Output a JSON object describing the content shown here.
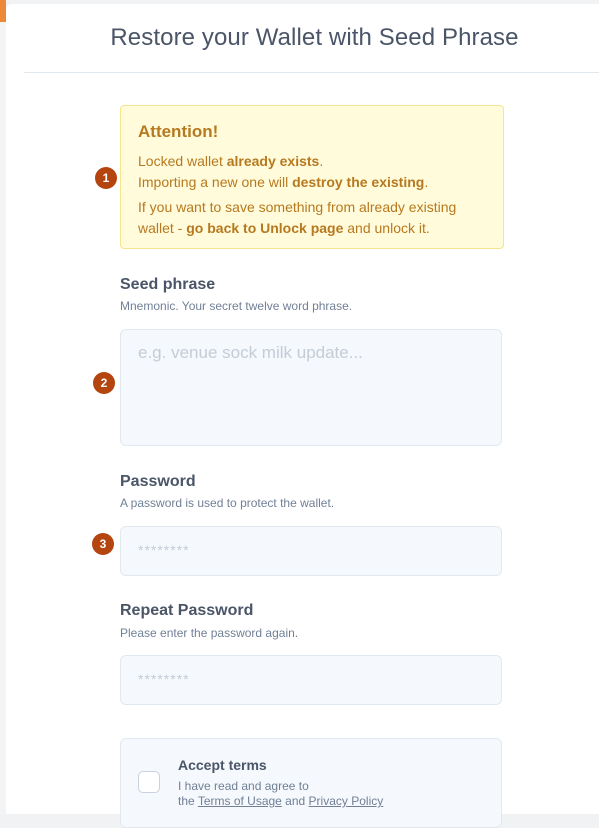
{
  "page": {
    "title": "Restore your Wallet with Seed Phrase"
  },
  "badges": [
    "1",
    "2",
    "3"
  ],
  "alert": {
    "title": "Attention!",
    "line1_pre": "Locked wallet ",
    "line1_bold": "already exists",
    "line1_post": ".",
    "line2_pre": "Importing a new one will ",
    "line2_bold": "destroy the existing",
    "line2_post": ".",
    "line3": "If you want to save something from already existing",
    "line4_pre": "wallet - ",
    "line4_bold": "go back to Unlock page",
    "line4_post": " and unlock it."
  },
  "seed": {
    "label": "Seed phrase",
    "description": "Mnemonic. Your secret twelve word phrase.",
    "placeholder": "e.g. venue sock milk update..."
  },
  "password": {
    "label": "Password",
    "description": "A password is used to protect the wallet.",
    "placeholder": "********"
  },
  "repeat_password": {
    "label": "Repeat Password",
    "description": "Please enter the password again.",
    "placeholder": "********"
  },
  "terms": {
    "title": "Accept terms",
    "line1": "I have read and agree to",
    "line2_pre": "the ",
    "terms_link": "Terms of Usage",
    "and": " and ",
    "privacy_link": "Privacy Policy"
  }
}
